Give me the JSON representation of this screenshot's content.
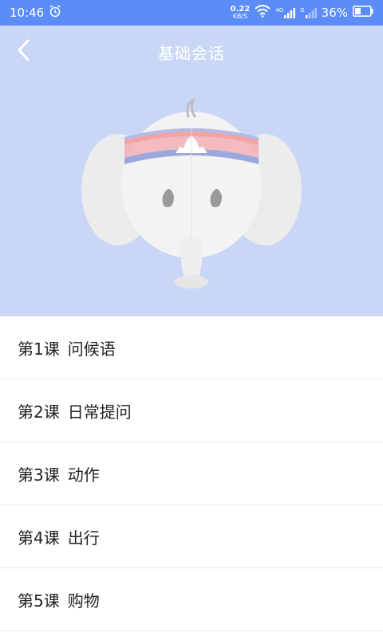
{
  "status_bar": {
    "time": "10:46",
    "net_speed_value": "0.22",
    "net_speed_unit": "KB/S",
    "signal1_label": "4G",
    "signal2_label": "G",
    "battery": "36%"
  },
  "header": {
    "title": "基础会话",
    "bg_color": "#c9d6f6"
  },
  "lessons": [
    {
      "number": "第1课",
      "name": "问候语"
    },
    {
      "number": "第2课",
      "name": "日常提问"
    },
    {
      "number": "第3课",
      "name": "动作"
    },
    {
      "number": "第4课",
      "name": "出行"
    },
    {
      "number": "第5课",
      "name": "购物"
    }
  ]
}
